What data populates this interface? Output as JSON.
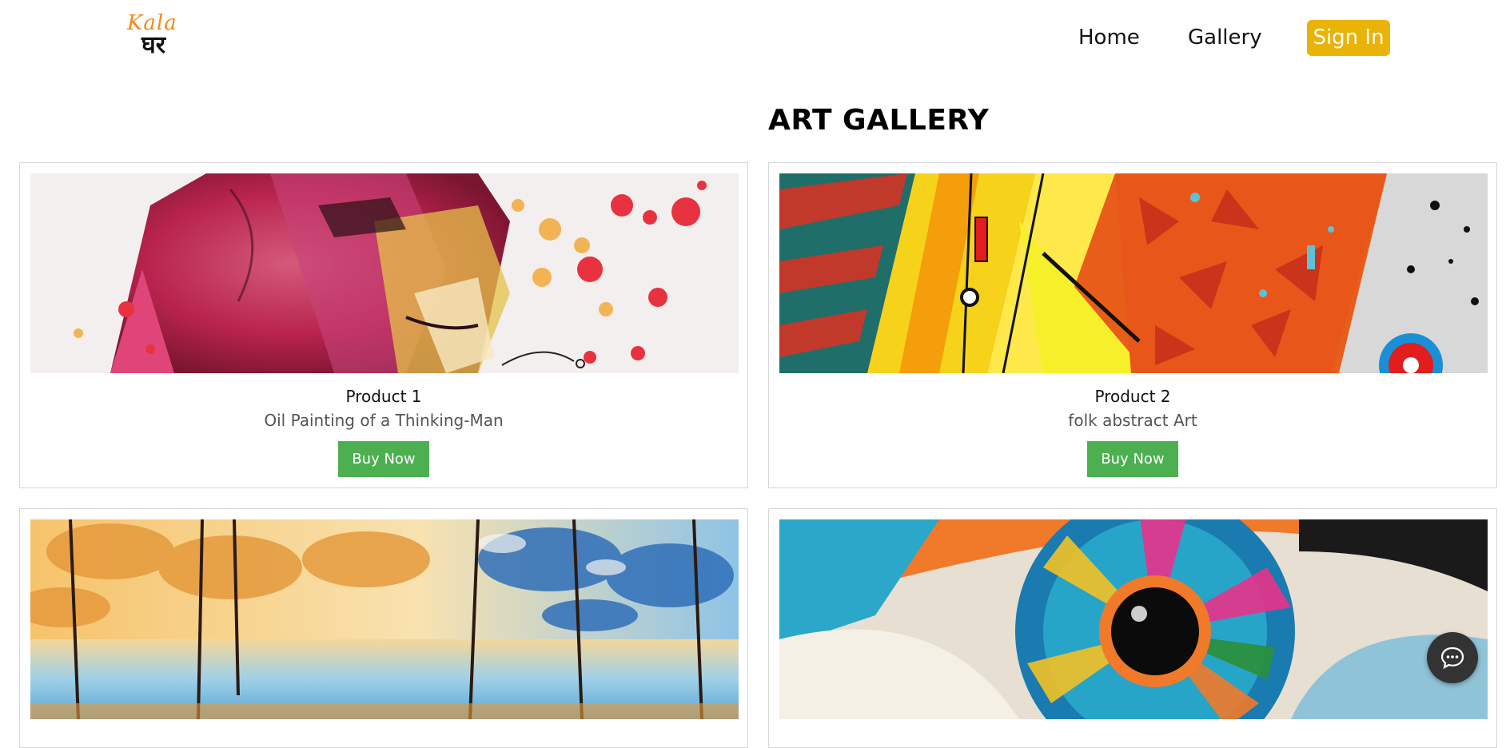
{
  "header": {
    "logo": {
      "latin": "Kala",
      "devanagari": "घर"
    },
    "nav": {
      "home": "Home",
      "gallery": "Gallery",
      "sign_in": "Sign In"
    },
    "colors": {
      "sign_in_bg": "#eab308"
    }
  },
  "main": {
    "title": "ART GALLERY",
    "products": [
      {
        "name": "Product 1",
        "description": "Oil Painting of a Thinking-Man",
        "button": "Buy Now"
      },
      {
        "name": "Product 2",
        "description": "folk abstract Art",
        "button": "Buy Now"
      },
      {
        "name": "",
        "description": "",
        "button": ""
      },
      {
        "name": "",
        "description": "",
        "button": ""
      }
    ],
    "colors": {
      "buy_button_bg": "#4caf50"
    }
  },
  "chat": {
    "icon": "chat-bubble-icon"
  }
}
